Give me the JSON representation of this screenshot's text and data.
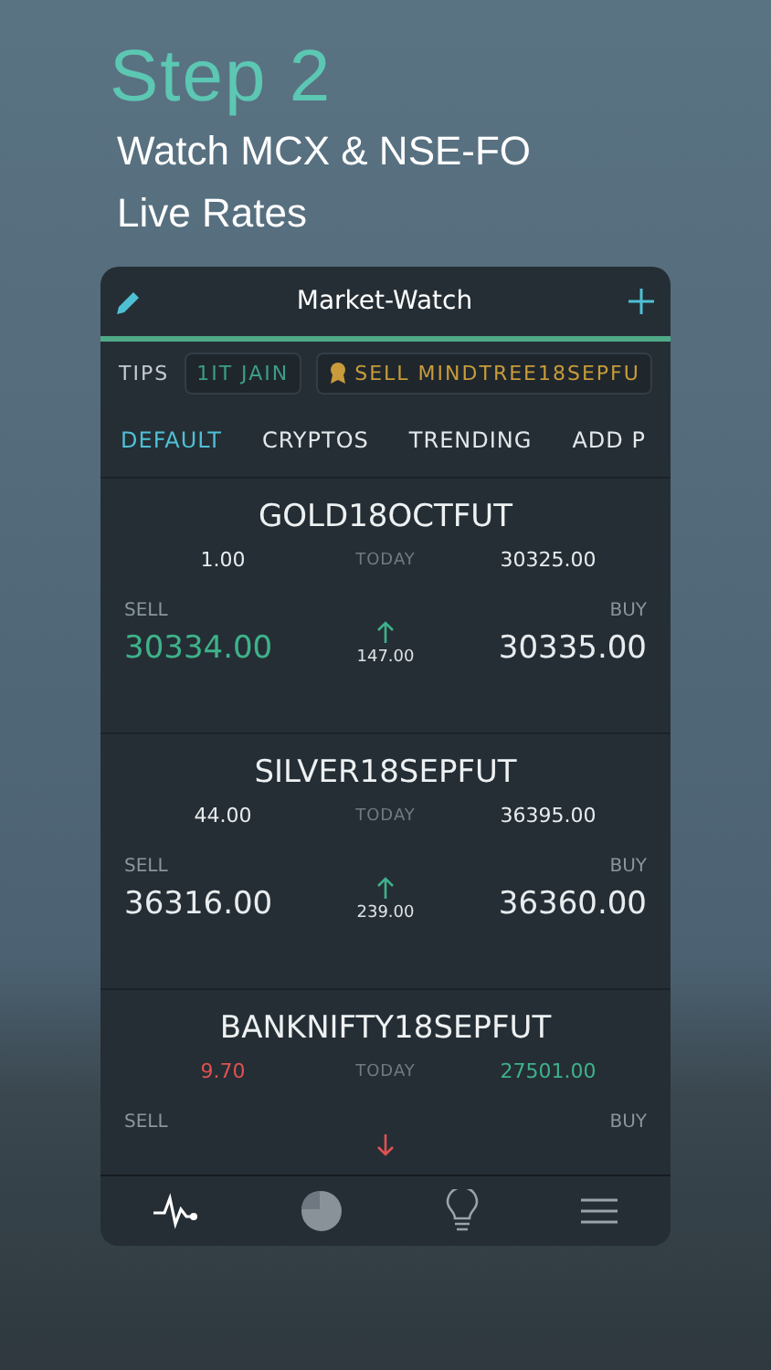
{
  "headline": {
    "step": "Step 2",
    "lines": [
      "Watch MCX & NSE-FO",
      "Live Rates"
    ]
  },
  "app": {
    "title": "Market-Watch",
    "tips": {
      "label": "TIPS",
      "items": [
        {
          "text": "1IT JAIN",
          "kind": "plain"
        },
        {
          "text": "SELL MINDTREE18SEPFU",
          "kind": "award"
        }
      ]
    },
    "tabs": [
      {
        "label": "DEFAULT",
        "selected": true
      },
      {
        "label": "CRYPTOS",
        "selected": false
      },
      {
        "label": "TRENDING",
        "selected": false
      },
      {
        "label": "ADD P",
        "selected": false
      }
    ],
    "quotes": [
      {
        "symbol": "GOLD18OCTFUT",
        "change": {
          "text": "1.00",
          "kind": "flat"
        },
        "today_label": "TODAY",
        "price": {
          "text": "30325.00",
          "kind": "flat"
        },
        "sell_label": "SELL",
        "buy_label": "BUY",
        "sell": {
          "text": "30334.00",
          "kind": "up"
        },
        "buy": {
          "text": "30335.00",
          "kind": "flat"
        },
        "movement": {
          "kind": "up",
          "text": "147.00"
        }
      },
      {
        "symbol": "SILVER18SEPFUT",
        "change": {
          "text": "44.00",
          "kind": "flat"
        },
        "today_label": "TODAY",
        "price": {
          "text": "36395.00",
          "kind": "flat"
        },
        "sell_label": "SELL",
        "buy_label": "BUY",
        "sell": {
          "text": "36316.00",
          "kind": "flat"
        },
        "buy": {
          "text": "36360.00",
          "kind": "flat"
        },
        "movement": {
          "kind": "up",
          "text": "239.00"
        }
      },
      {
        "symbol": "BANKNIFTY18SEPFUT",
        "change": {
          "text": "9.70",
          "kind": "down"
        },
        "today_label": "TODAY",
        "price": {
          "text": "27501.00",
          "kind": "up"
        },
        "sell_label": "SELL",
        "buy_label": "BUY",
        "movement": {
          "kind": "down"
        }
      }
    ],
    "nav": [
      {
        "kind": "pulse",
        "selected": true
      },
      {
        "kind": "pie",
        "selected": false
      },
      {
        "kind": "bulb",
        "selected": false
      },
      {
        "kind": "menu",
        "selected": false
      }
    ]
  }
}
